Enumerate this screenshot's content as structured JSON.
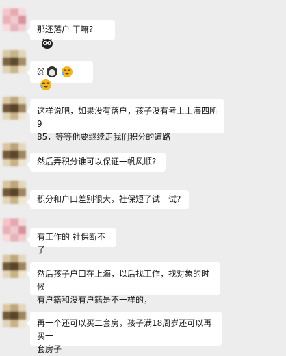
{
  "messages": [
    {
      "text": "那还落户 干嘛?",
      "suffix_icon": "owl-emoji-icon"
    },
    {
      "text": "@",
      "emojis": [
        "cat-emoji-icon",
        "laughing-face-icon",
        "laughing-face-icon"
      ]
    },
    {
      "lines": [
        "这样说吧，如果没有落户，孩子没有考上上海四所9",
        "85，等等他要继续走我们积分的道路"
      ]
    },
    {
      "text": "然后弄积分谁可以保证一帆风顺?"
    },
    {
      "text": "积分和户口差别很大，社保短了试一试?"
    },
    {
      "text": "有工作的 社保断不了"
    },
    {
      "lines": [
        "然后孩子户口在上海，以后找工作，找对象的时候",
        "有户籍和没有户籍是不一样的，"
      ]
    },
    {
      "lines": [
        "再一个还可以买二套房，孩子满18周岁还可以再买一",
        "套房子"
      ]
    }
  ],
  "colors": {
    "background": "#ededed",
    "bubble": "#ffffff",
    "emoji_yellow": "#f3b61f"
  }
}
